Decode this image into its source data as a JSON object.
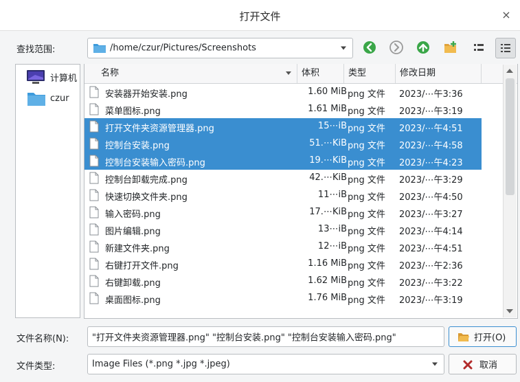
{
  "window": {
    "title": "打开文件",
    "close_glyph": "×"
  },
  "lookin": {
    "label": "查找范围:",
    "path": "/home/czur/Pictures/Screenshots"
  },
  "nav_icons": [
    "back-icon",
    "forward-icon",
    "parent-folder-icon",
    "new-folder-icon",
    "list-view-icon",
    "detail-view-icon"
  ],
  "places": [
    {
      "label": "计算机",
      "icon": "computer-icon"
    },
    {
      "label": "czur",
      "icon": "folder-icon"
    }
  ],
  "columns": {
    "name": "名称",
    "size": "体积",
    "type": "类型",
    "date": "修改日期"
  },
  "files": [
    {
      "name": "安装器开始安装.png",
      "size": "1.60 MiB",
      "type": "png 文件",
      "date": "2023/⋯午3:36",
      "selected": false
    },
    {
      "name": "菜单图标.png",
      "size": "1.61 MiB",
      "type": "png 文件",
      "date": "2023/⋯午3:19",
      "selected": false
    },
    {
      "name": "打开文件夹资源管理器.png",
      "size": "15⋯iB",
      "type": "png 文件",
      "date": "2023/⋯午4:51",
      "selected": true
    },
    {
      "name": "控制台安装.png",
      "size": "51.⋯KiB",
      "type": "png 文件",
      "date": "2023/⋯午4:58",
      "selected": true
    },
    {
      "name": "控制台安装输入密码.png",
      "size": "19.⋯KiB",
      "type": "png 文件",
      "date": "2023/⋯午4:23",
      "selected": true
    },
    {
      "name": "控制台卸载完成.png",
      "size": "42.⋯KiB",
      "type": "png 文件",
      "date": "2023/⋯午3:29",
      "selected": false
    },
    {
      "name": "快速切换文件夹.png",
      "size": "11⋯iB",
      "type": "png 文件",
      "date": "2023/⋯午4:50",
      "selected": false
    },
    {
      "name": "输入密码.png",
      "size": "17.⋯KiB",
      "type": "png 文件",
      "date": "2023/⋯午3:27",
      "selected": false
    },
    {
      "name": "图片编辑.png",
      "size": "13⋯iB",
      "type": "png 文件",
      "date": "2023/⋯午4:14",
      "selected": false
    },
    {
      "name": "新建文件夹.png",
      "size": "12⋯iB",
      "type": "png 文件",
      "date": "2023/⋯午4:51",
      "selected": false
    },
    {
      "name": "右键打开文件.png",
      "size": "1.16 MiB",
      "type": "png 文件",
      "date": "2023/⋯午2:36",
      "selected": false
    },
    {
      "name": "右键卸载.png",
      "size": "1.62 MiB",
      "type": "png 文件",
      "date": "2023/⋯午3:22",
      "selected": false
    },
    {
      "name": "桌面图标.png",
      "size": "1.76 MiB",
      "type": "png 文件",
      "date": "2023/⋯午3:19",
      "selected": false
    }
  ],
  "filename": {
    "label": "文件名称(N):",
    "value": "\"打开文件夹资源管理器.png\" \"控制台安装.png\" \"控制台安装输入密码.png\""
  },
  "filetype": {
    "label": "文件类型:",
    "value": "Image Files (*.png *.jpg *.jpeg)"
  },
  "buttons": {
    "open": "打开(O)",
    "cancel": "取消"
  },
  "colors": {
    "selection": "#3a8ed0",
    "nav_green": "#3aa648",
    "folder_blue": "#3d9bdc"
  }
}
